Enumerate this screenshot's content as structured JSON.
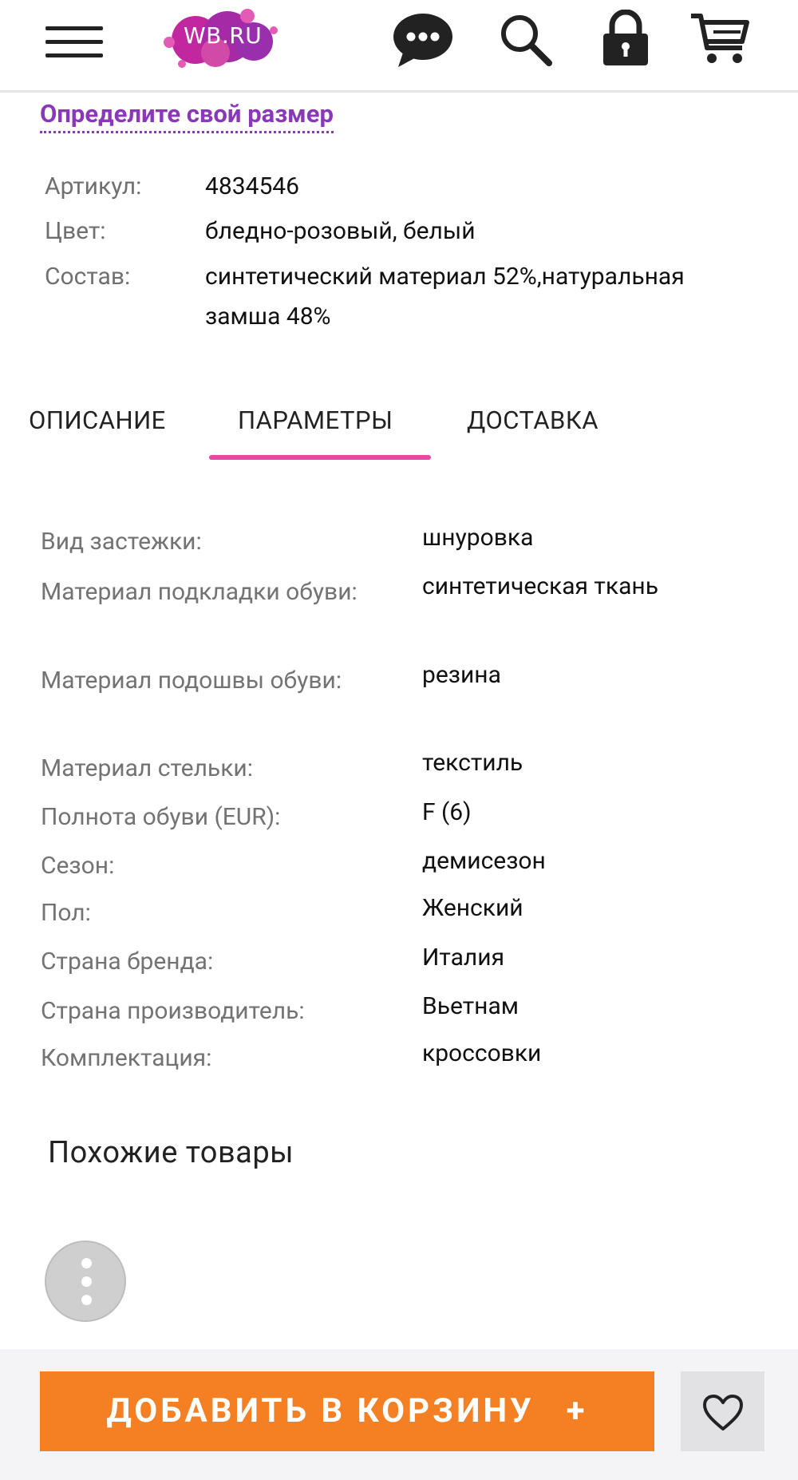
{
  "header": {
    "logo_text": "WB.RU"
  },
  "size_link": "Определите свой размер",
  "product_info": [
    {
      "label": "Артикул:",
      "value": "4834546"
    },
    {
      "label": "Цвет:",
      "value": "бледно-розовый, белый"
    },
    {
      "label": "Состав:",
      "value": "синтетический материал 52%,натуральная замша 48%"
    }
  ],
  "tabs": [
    {
      "label": "ОПИСАНИЕ",
      "active": false
    },
    {
      "label": "ПАРАМЕТРЫ",
      "active": true
    },
    {
      "label": "ДОСТАВКА",
      "active": false
    }
  ],
  "params": [
    {
      "label": "Вид застежки:",
      "value": "шнуровка"
    },
    {
      "label": "Материал подкладки обуви:",
      "value": "синтетическая ткань"
    },
    {
      "label": "Материал подошвы обуви:",
      "value": "резина"
    },
    {
      "label": "Материал стельки:",
      "value": "текстиль"
    },
    {
      "label": "Полнота обуви (EUR):",
      "value": "F (6)"
    },
    {
      "label": "Сезон:",
      "value": "демисезон"
    },
    {
      "label": "Пол:",
      "value": "Женский"
    },
    {
      "label": "Страна бренда:",
      "value": "Италия"
    },
    {
      "label": "Страна производитель:",
      "value": "Вьетнам"
    },
    {
      "label": "Комплектация:",
      "value": "кроссовки"
    }
  ],
  "similar_title": "Похожие товары",
  "add_to_cart": {
    "label": "ДОБАВИТЬ В КОРЗИНУ",
    "plus": "+"
  },
  "colors": {
    "accent_purple": "#8a38b8",
    "tab_underline": "#e74aa2",
    "cart_button": "#f57f23"
  }
}
